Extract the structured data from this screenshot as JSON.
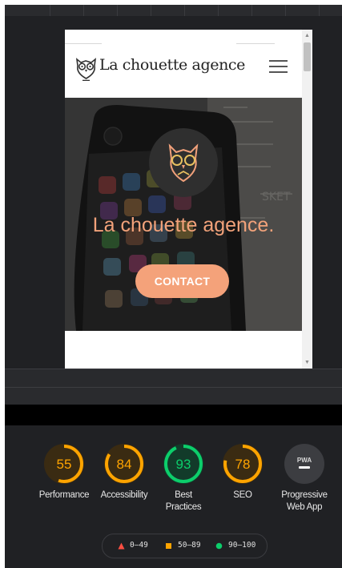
{
  "site": {
    "brand": "La chouette agence",
    "hero_title": "La chouette agence.",
    "cta_label": "CONTACT",
    "icons": {
      "logo": "owl-icon",
      "menu": "hamburger-menu-icon"
    }
  },
  "scores": [
    {
      "name": "performance",
      "value": "55",
      "label_lines": [
        "Performance"
      ],
      "fraction": 0.55,
      "status": "average"
    },
    {
      "name": "accessibility",
      "value": "84",
      "label_lines": [
        "Accessibility"
      ],
      "fraction": 0.84,
      "status": "average"
    },
    {
      "name": "best-practices",
      "value": "93",
      "label_lines": [
        "Best",
        "Practices"
      ],
      "fraction": 0.93,
      "status": "pass"
    },
    {
      "name": "seo",
      "value": "78",
      "label_lines": [
        "SEO"
      ],
      "fraction": 0.78,
      "status": "average"
    },
    {
      "name": "pwa",
      "value": "PWA",
      "label_lines": [
        "Progressive",
        "Web App"
      ],
      "status": "pwa"
    }
  ],
  "legend": [
    {
      "range": "0–49",
      "shape": "triangle",
      "color": "#ff4e42"
    },
    {
      "range": "50–89",
      "shape": "square",
      "color": "#ffa400"
    },
    {
      "range": "90–100",
      "shape": "circle",
      "color": "#0cce6b"
    }
  ],
  "colors": {
    "average": "#ffa400",
    "pass": "#0cce6b",
    "fail": "#ff4e42",
    "average_bg": "#3a2b12",
    "pass_bg": "#123b2a",
    "accent": "#f4a27a"
  }
}
